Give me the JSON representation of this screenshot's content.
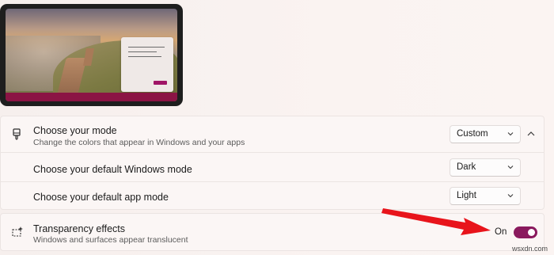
{
  "mode": {
    "title": "Choose your mode",
    "description": "Change the colors that appear in Windows and your apps",
    "value": "Custom"
  },
  "windows_mode": {
    "title": "Choose your default Windows mode",
    "value": "Dark"
  },
  "app_mode": {
    "title": "Choose your default app mode",
    "value": "Light"
  },
  "transparency": {
    "title": "Transparency effects",
    "description": "Windows and surfaces appear translucent",
    "state_label": "On",
    "enabled": true
  },
  "watermark": "wsxdn.com",
  "colors": {
    "accent": "#8a1a5e",
    "taskbar": "#8b1444",
    "arrow": "#e8141b"
  },
  "icons": {
    "mode": "paintbrush-icon",
    "transparency": "transparency-sparkle-icon",
    "dropdown": "chevron-down-icon",
    "collapse": "chevron-up-icon"
  }
}
